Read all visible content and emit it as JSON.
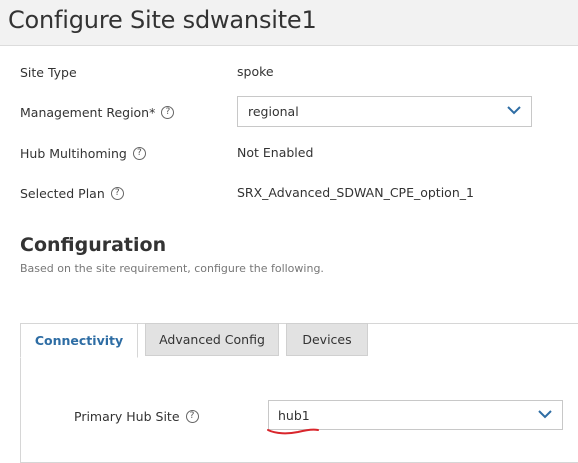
{
  "header": {
    "title": "Configure Site sdwansite1"
  },
  "site_info": {
    "site_type_label": "Site Type",
    "site_type_value": "spoke",
    "mgmt_region_label": "Management Region*",
    "mgmt_region_value": "regional",
    "hub_multihoming_label": "Hub Multihoming",
    "hub_multihoming_value": "Not Enabled",
    "selected_plan_label": "Selected Plan",
    "selected_plan_value": "SRX_Advanced_SDWAN_CPE_option_1"
  },
  "configuration": {
    "title": "Configuration",
    "subtitle": "Based on the site requirement, configure the following."
  },
  "tabs": [
    {
      "label": "Connectivity",
      "active": true
    },
    {
      "label": "Advanced Config",
      "active": false
    },
    {
      "label": "Devices",
      "active": false
    }
  ],
  "connectivity": {
    "primary_hub_label": "Primary Hub Site",
    "primary_hub_value": "hub1"
  },
  "icons": {
    "help": "help-circle-icon",
    "dropdown": "chevron-down-icon"
  },
  "colors": {
    "accent": "#2e6da4",
    "annotation_underline": "#d9262c"
  }
}
